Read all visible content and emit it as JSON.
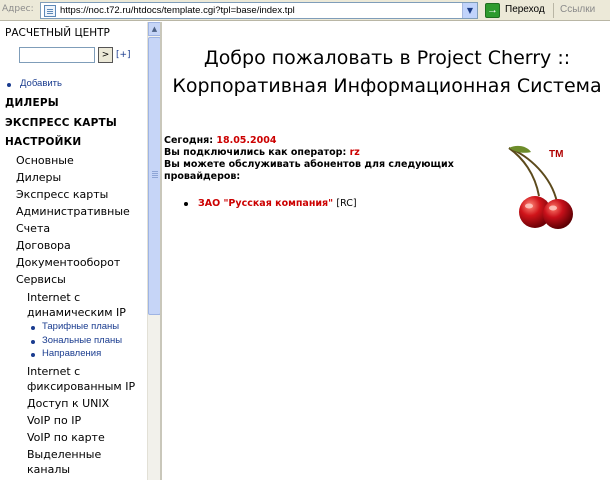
{
  "browser": {
    "address_label": "Адрес:",
    "url": "https://noc.t72.ru/htdocs/template.cgi?tpl=base/index.tpl",
    "go_label": "Переход",
    "links_label": "Ссылки"
  },
  "sidebar": {
    "center_title": "РАСЧЕТНЫЙ ЦЕНТР",
    "search": {
      "value": "",
      "button": ">",
      "plus": "[+]"
    },
    "add_link": "Добавить",
    "sections": [
      "ДИЛЕРЫ",
      "ЭКСПРЕСС КАРТЫ",
      "НАСТРОЙКИ"
    ],
    "settings_items": [
      "Основные",
      "Дилеры",
      "Экспресс карты",
      "Административные",
      "Счета",
      "Договора",
      "Документооборот",
      "Сервисы"
    ],
    "services": {
      "dynamic_ip": "Internet с динамическим IP",
      "dynamic_ip_items": [
        "Тарифные планы",
        "Зональные планы",
        "Направления"
      ],
      "fixed_ip": "Internet с фиксированным IP",
      "others": [
        "Доступ к UNIX",
        "VoIP по IP",
        "VoIP по карте"
      ],
      "dedicated": "Выделенные каналы"
    }
  },
  "main": {
    "title_line1": "Добро пожаловать в Project Cherry ::",
    "title_line2": "Корпоративная Информационная Система",
    "today_label": "Сегодня:",
    "today_value": "18.05.2004",
    "operator_label": "Вы подключились как оператор:",
    "operator_value": "rz",
    "providers_text": "Вы можете обслуживать абонентов для следующих провайдеров:",
    "provider_name": "ЗАО \"Русская компания\"",
    "provider_tag": "[RC]",
    "logo_tm": "TM"
  },
  "colors": {
    "accent_red": "#cc0000",
    "link_blue": "#1a3c8f"
  }
}
